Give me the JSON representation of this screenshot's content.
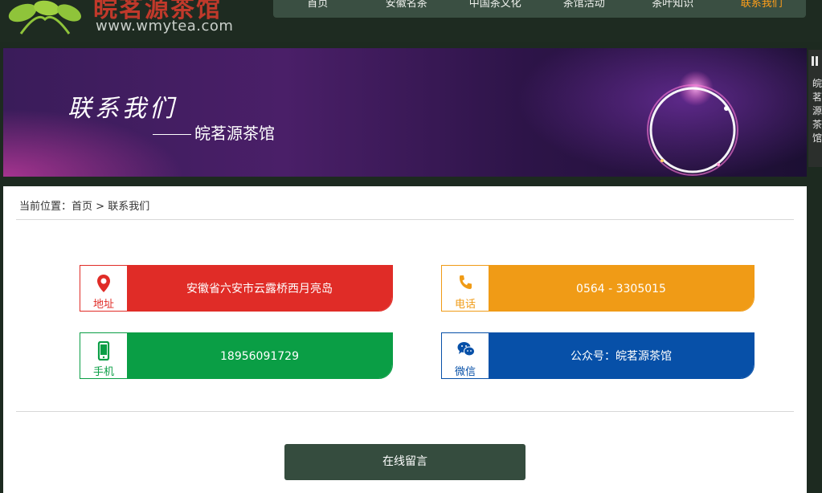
{
  "header": {
    "logo_title": "皖茗源茶馆",
    "logo_url": "www.wmytea.com",
    "nav": [
      {
        "label": "首页",
        "active": false
      },
      {
        "label": "安徽名茶",
        "active": false
      },
      {
        "label": "中国茶文化",
        "active": false
      },
      {
        "label": "茶馆活动",
        "active": false
      },
      {
        "label": "茶叶知识",
        "active": false
      },
      {
        "label": "联系我们",
        "active": true
      }
    ],
    "nav_active_color": "#ff9f1a"
  },
  "banner": {
    "title": "联系我们",
    "subtitle": "皖茗源茶馆"
  },
  "side_float": {
    "text": "皖茗源茶馆"
  },
  "breadcrumb": {
    "prefix": "当前位置：",
    "home": "首页",
    "sep": " > ",
    "current": "联系我们"
  },
  "contact": {
    "address": {
      "label": "地址",
      "value": "安徽省六安市云露桥西月亮岛",
      "icon": "map-pin-icon",
      "color": "#e02c27"
    },
    "phone": {
      "label": "电话",
      "value": "0564 - 3305015",
      "icon": "phone-icon",
      "color": "#f09b16"
    },
    "mobile": {
      "label": "手机",
      "value": "18956091729",
      "icon": "mobile-icon",
      "color": "#0a9e45"
    },
    "wechat": {
      "label": "微信",
      "value": "公众号：皖茗源茶馆",
      "icon": "wechat-icon",
      "color": "#0750a8"
    }
  },
  "message_button": {
    "label": "在线留言"
  }
}
